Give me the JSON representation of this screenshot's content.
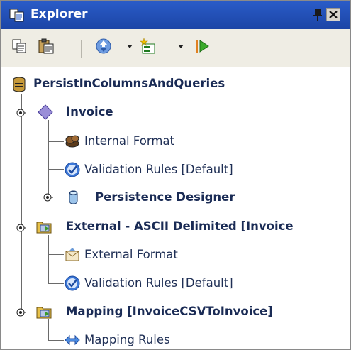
{
  "panel": {
    "title": "Explorer",
    "icons": {
      "title": "explorer-icon",
      "pin": "pin-icon",
      "close": "close-icon"
    }
  },
  "toolbar": {
    "buttons": [
      {
        "name": "copy",
        "icon": "copy-icon"
      },
      {
        "name": "paste",
        "icon": "paste-icon"
      },
      {
        "name": "sync",
        "icon": "sync-icon",
        "has_dropdown": true
      },
      {
        "name": "new",
        "icon": "new-item-icon",
        "has_dropdown": true
      },
      {
        "name": "run",
        "icon": "run-icon"
      }
    ]
  },
  "tree": {
    "root": {
      "label": "PersistInColumnsAndQueries",
      "icon": "database-icon"
    },
    "nodes": [
      {
        "label": "Invoice",
        "icon": "diamond-icon",
        "bold": true,
        "expandable": true
      },
      {
        "label": "Internal Format",
        "icon": "internal-format-icon"
      },
      {
        "label": "Validation Rules [Default]",
        "icon": "validation-icon"
      },
      {
        "label": "Persistence Designer",
        "icon": "persistence-icon",
        "bold": true,
        "expandable": true
      },
      {
        "label": "External - ASCII Delimited [Invoice",
        "icon": "external-folder-icon",
        "bold": true,
        "expandable": true
      },
      {
        "label": "External Format",
        "icon": "envelope-icon"
      },
      {
        "label": "Validation Rules [Default]",
        "icon": "validation-icon"
      },
      {
        "label": "Mapping [InvoiceCSVToInvoice]",
        "icon": "mapping-folder-icon",
        "bold": true,
        "expandable": true
      },
      {
        "label": "Mapping Rules",
        "icon": "mapping-rules-icon"
      }
    ]
  },
  "colors": {
    "titlebar": "#2a5cc8",
    "toolbar": "#efede4",
    "label_text": "#1f2f55"
  }
}
